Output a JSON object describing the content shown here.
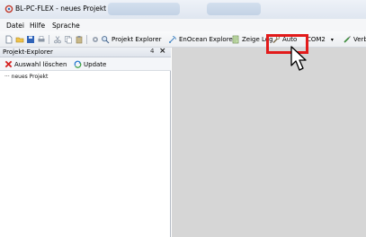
{
  "window": {
    "title": "BL-PC-FLEX - neues Projekt"
  },
  "menu": {
    "items": [
      "Datei",
      "Hilfe",
      "Sprache"
    ]
  },
  "toolbar": {
    "projekt_explorer": "Projekt Explorer",
    "enocean_explorer": "EnOcean Explorer",
    "zeige_log": "Zeige Log",
    "auto": "Auto",
    "com_port": "COM2",
    "verbinden": "Verb"
  },
  "panel": {
    "title": "Projekt-Explorer",
    "pin": "4",
    "close": "×",
    "auswahl_loeschen": "Auswahl löschen",
    "update": "Update",
    "tree_root": "neues Projekt"
  },
  "colors": {
    "highlight": "#e21a1a",
    "workspace": "#d6d6d6"
  }
}
